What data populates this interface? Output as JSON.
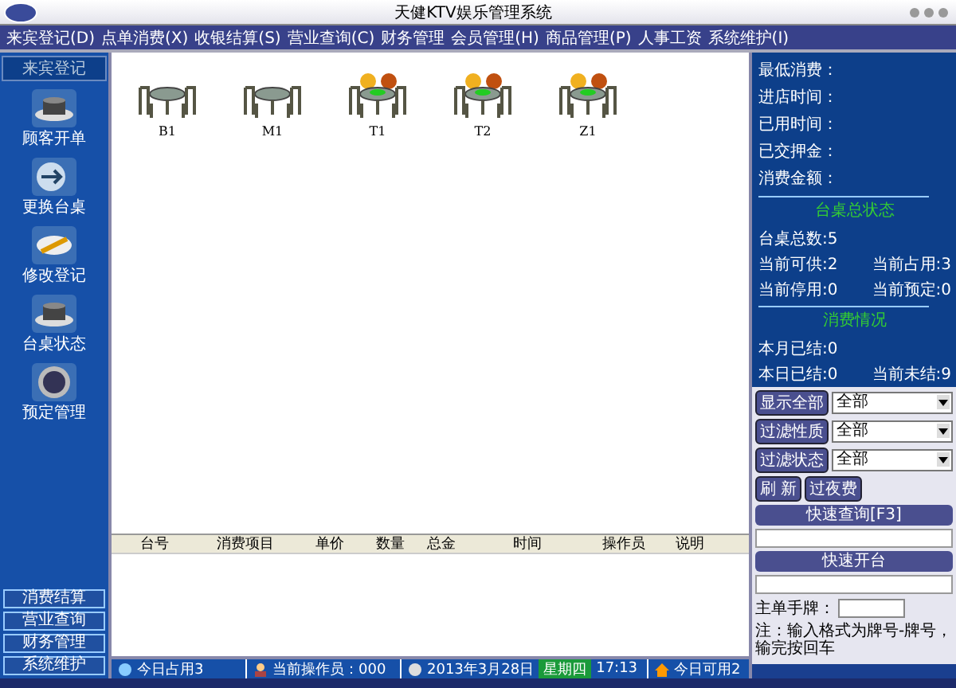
{
  "window": {
    "title": "天健KTV娱乐管理系统"
  },
  "menu": [
    "来宾登记(D)",
    "点单消费(X)",
    "收银结算(S)",
    "营业查询(C)",
    "财务管理",
    "会员管理(H)",
    "商品管理(P)",
    "人事工资",
    "系统维护(I)"
  ],
  "sidebar": {
    "header": "来宾登记",
    "items": [
      {
        "label": "顾客开单",
        "kind": "pot"
      },
      {
        "label": "更换台桌",
        "kind": "swap"
      },
      {
        "label": "修改登记",
        "kind": "edit"
      },
      {
        "label": "台桌状态",
        "kind": "pot"
      },
      {
        "label": "预定管理",
        "kind": "plate"
      }
    ],
    "bottom_items": [
      "消费结算",
      "营业查询",
      "财务管理",
      "系统维护"
    ]
  },
  "rooms": [
    {
      "name": "B1",
      "occupied": false
    },
    {
      "name": "M1",
      "occupied": false
    },
    {
      "name": "T1",
      "occupied": true
    },
    {
      "name": "T2",
      "occupied": true
    },
    {
      "name": "Z1",
      "occupied": true
    }
  ],
  "table": {
    "columns": [
      "台号",
      "消费项目",
      "单价",
      "数量",
      "总金",
      "时间",
      "操作员",
      "说明"
    ]
  },
  "info": {
    "fields": [
      "最低消费：",
      "进店时间：",
      "已用时间：",
      "已交押金：",
      "消费金额："
    ],
    "status_title": "台桌总状态",
    "total": "台桌总数:5",
    "status_pairs": [
      [
        "当前可供:2",
        "当前占用:3"
      ],
      [
        "当前停用:0",
        "当前预定:0"
      ]
    ],
    "consume_title": "消费情况",
    "month": "本月已结:0",
    "today": "本日已结:0",
    "unsettled": "当前未结:9"
  },
  "filters": [
    {
      "button": "显示全部",
      "value": "全部"
    },
    {
      "button": "过滤性质",
      "value": "全部"
    },
    {
      "button": "过滤状态",
      "value": "全部"
    }
  ],
  "actions": [
    "刷  新",
    "过夜费"
  ],
  "quick_query": "快速查询[F3]",
  "quick_open": "快速开台",
  "tag_label": "主单手牌：",
  "note": "注：输入格式为牌号-牌号，输完按回车",
  "status_bar": {
    "today_used": "今日占用3",
    "operator": "当前操作员：000",
    "date": "2013年3月28日",
    "weekday": "星期四",
    "time": "17:13",
    "today_free": "今日可用2"
  }
}
